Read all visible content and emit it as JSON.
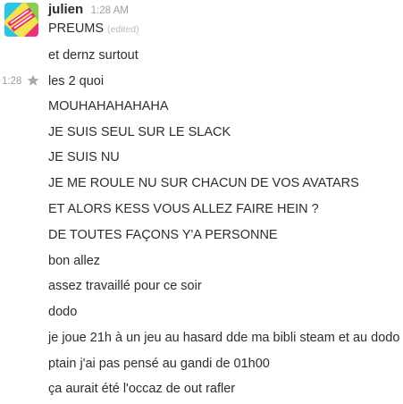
{
  "author": {
    "name": "julien",
    "time": "1:28 AM"
  },
  "hover": {
    "time": "1:28"
  },
  "messages": [
    {
      "text": "PREUMS",
      "edited": "(edited)"
    },
    {
      "text": "et dernz surtout"
    },
    {
      "text": "les 2 quoi"
    },
    {
      "text": "MOUHAHAHAHAHA"
    },
    {
      "text": "JE SUIS SEUL SUR LE SLACK"
    },
    {
      "text": "JE SUIS NU"
    },
    {
      "text": "JE ME ROULE NU SUR CHACUN DE VOS AVATARS"
    },
    {
      "text": "ET ALORS KESS VOUS ALLEZ FAIRE HEIN ?"
    },
    {
      "text": "DE TOUTES FAÇONS Y'A PERSONNE"
    },
    {
      "text": "bon allez"
    },
    {
      "text": "assez travaillé pour ce soir"
    },
    {
      "text": "dodo"
    },
    {
      "text": "je joue 21h à un jeu au hasard dde ma bibli steam et au dodo"
    },
    {
      "text": "ptain j'ai pas pensé au gandi de 01h00"
    },
    {
      "text": "ça aurait été l'occaz de out rafler"
    }
  ],
  "colors": {
    "text": "#2c2d30",
    "muted": "#9e9ea6",
    "avatar_yellow": "#f4e64a",
    "avatar_cyan": "#2ec4e6",
    "avatar_pink": "#e8327c",
    "avatar_green": "#8ad04a"
  },
  "icons": {
    "star": "star-icon",
    "avatar": "user-avatar"
  }
}
